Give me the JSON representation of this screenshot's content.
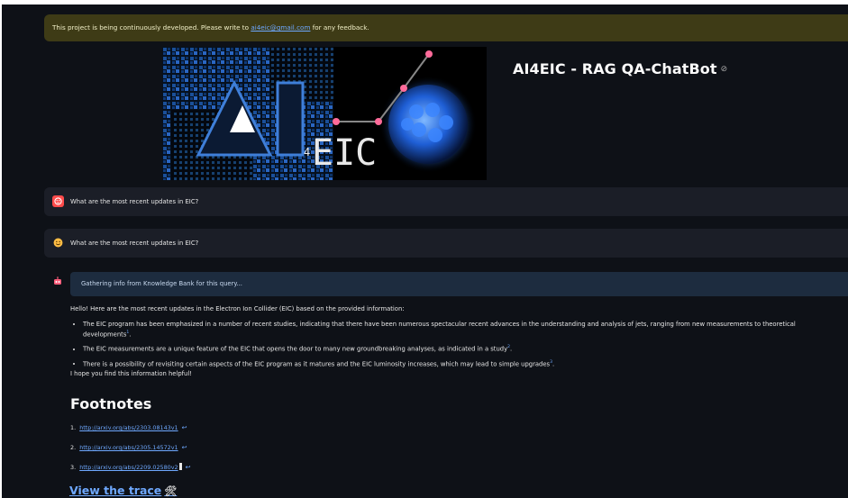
{
  "banner": {
    "text_before": "This project is being continuously developed. Please write to ",
    "email": "ai4eic@gmail.com",
    "text_after": " for any feedback."
  },
  "hero": {
    "logo_text_ai": "AI",
    "logo_text_sub": "4",
    "logo_text_eic": "EIC"
  },
  "header": {
    "title": "AI4EIC - RAG QA-ChatBot",
    "anchor_icon": "link-icon"
  },
  "chat": {
    "messages": [
      {
        "role": "user",
        "avatar_icon": "user-face-icon",
        "text": "What are the most recent updates in EIC?"
      },
      {
        "role": "user",
        "avatar_icon": "smiley-icon",
        "text": "What are the most recent updates in EIC?"
      }
    ],
    "assistant": {
      "avatar_icon": "robot-icon",
      "status": "Gathering info from Knowledge Bank for this query...",
      "intro": "Hello! Here are the most recent updates in the Electron Ion Collider (EIC) based on the provided information:",
      "bullets": [
        {
          "text": "The EIC program has been emphasized in a number of recent studies, indicating that there have been numerous spectacular recent advances in the understanding and analysis of jets, ranging from new measurements to theoretical developments",
          "ref": "1",
          "end": "."
        },
        {
          "text": "The EIC measurements are a unique feature of the EIC that opens the door to many new groundbreaking analyses, as indicated in a study",
          "ref": "2",
          "end": "."
        },
        {
          "text": "There is a possibility of revisiting certain aspects of the EIC program as it matures and the EIC luminosity increases, which may lead to simple upgrades",
          "ref": "3",
          "end": "."
        }
      ],
      "outro": "I hope you find this information helpful!",
      "footnotes_title": "Footnotes",
      "footnotes": [
        {
          "num": "1.",
          "url": "http://arxiv.org/abs/2303.08143v1",
          "back": "↩"
        },
        {
          "num": "2.",
          "url": "http://arxiv.org/abs/2305.14572v1",
          "back": "↩"
        },
        {
          "num": "3.",
          "url": "http://arxiv.org/abs/2209.02580v2",
          "back": "↩"
        }
      ],
      "trace_label": "View the trace",
      "trace_icon": "tools-icon"
    }
  },
  "colors": {
    "background": "#0e1117",
    "banner_bg": "#3e3b16",
    "message_bg": "#1b1e27",
    "status_bg": "#1d2c3f",
    "link": "#6ea8fe",
    "user_avatar": "#ff4b4b",
    "smiley_avatar": "#ffbd45"
  }
}
